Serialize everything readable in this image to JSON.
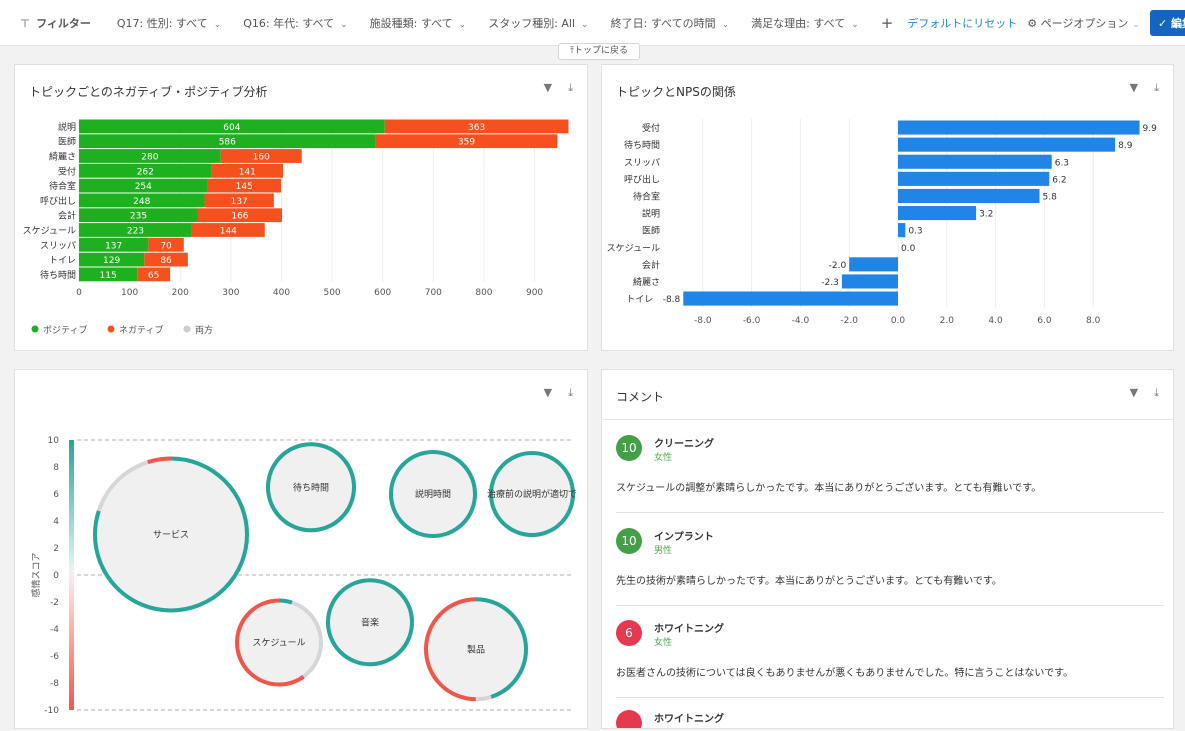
{
  "filterbar": {
    "title": "フィルター",
    "items": [
      "Q17: 性別: すべて",
      "Q16: 年代: すべて",
      "施設種類: すべて",
      "スタッフ種別: All",
      "終了日: すべての時間",
      "満足な理由: すべて"
    ],
    "add": "+",
    "reset": "デフォルトにリセット",
    "options": "ページオプション",
    "done": "編集を完了"
  },
  "back_to_top": "⤒トップに戻る",
  "panels": {
    "sentiment": {
      "title": "トピックごとのネガティブ・ポジティブ分析"
    },
    "nps": {
      "title": "トピックとNPSの関係"
    },
    "bubble": {
      "title": ""
    },
    "comments": {
      "title": "コメント"
    }
  },
  "comments": [
    {
      "score": "10",
      "score_color": "#43a047",
      "topic": "クリーニング",
      "gender": "女性",
      "text": "スケジュールの調整が素晴らしかったです。本当にありがとうございます。とても有難いです。"
    },
    {
      "score": "10",
      "score_color": "#43a047",
      "topic": "インプラント",
      "gender": "男性",
      "text": "先生の技術が素晴らしかったです。本当にありがとうございます。とても有難いです。"
    },
    {
      "score": "6",
      "score_color": "#e53950",
      "topic": "ホワイトニング",
      "gender": "女性",
      "text": "お医者さんの技術については良くもありませんが悪くもありませんでした。特に言うことはないです。"
    },
    {
      "score": "",
      "score_color": "#e53950",
      "topic": "ホワイトニング",
      "gender": "",
      "text": ""
    }
  ],
  "chart_data": [
    {
      "type": "bar",
      "orientation": "horizontal",
      "stacked": true,
      "categories": [
        "説明",
        "医師",
        "綺麗さ",
        "受付",
        "待合室",
        "呼び出し",
        "会計",
        "スケジュール",
        "スリッパ",
        "トイレ",
        "待ち時間"
      ],
      "series": [
        {
          "name": "ポジティブ",
          "color": "#1eb01e",
          "values": [
            604,
            586,
            280,
            262,
            254,
            248,
            235,
            223,
            137,
            129,
            115
          ]
        },
        {
          "name": "ネガティブ",
          "color": "#f4511e",
          "values": [
            363,
            359,
            160,
            141,
            145,
            137,
            166,
            144,
            70,
            86,
            65
          ]
        },
        {
          "name": "両方",
          "color": "#cccccc",
          "values": [
            0,
            0,
            0,
            0,
            0,
            0,
            0,
            0,
            0,
            0,
            0
          ]
        }
      ],
      "xticks": [
        "0",
        "100",
        "200",
        "300",
        "400",
        "500",
        "600",
        "700",
        "800",
        "900"
      ],
      "xlim": [
        0,
        970
      ],
      "legend": "bottom-left"
    },
    {
      "type": "bar",
      "orientation": "horizontal",
      "categories": [
        "受付",
        "待ち時間",
        "スリッパ",
        "呼び出し",
        "待合室",
        "説明",
        "医師",
        "スケジュール",
        "会計",
        "綺麗さ",
        "トイレ"
      ],
      "values": [
        9.9,
        8.9,
        6.3,
        6.2,
        5.8,
        3.2,
        0.3,
        0.0,
        -2.0,
        -2.3,
        -8.8
      ],
      "labels": [
        "9.9",
        "8.9",
        "6.3",
        "6.2",
        "5.8",
        "3.2",
        "0.3",
        "0.0",
        "-2.0",
        "-2.3",
        "-8.8"
      ],
      "color": "#2185e8",
      "xticks": [
        "-8.0",
        "-6.0",
        "-4.0",
        "-2.0",
        "0.0",
        "2.0",
        "4.0",
        "6.0",
        "8.0"
      ],
      "xlim": [
        -9,
        10
      ]
    },
    {
      "type": "scatter",
      "style": "bubble",
      "ylabel": "感情スコア",
      "yticks": [
        "10",
        "8",
        "6",
        "4",
        "2",
        "0",
        "-2",
        "-4",
        "-6",
        "-8",
        "-10"
      ],
      "ylim": [
        -10,
        10
      ],
      "points": [
        {
          "label": "サービス",
          "y": 3,
          "positive_share": 0.8,
          "negative_share": 0.05
        },
        {
          "label": "待ち時間",
          "y": 6.5,
          "positive_share": 1.0,
          "negative_share": 0.0
        },
        {
          "label": "説明時間",
          "y": 6,
          "positive_share": 1.0,
          "negative_share": 0.0
        },
        {
          "label": "治療前の説明が適切で",
          "y": 6,
          "positive_share": 1.0,
          "negative_share": 0.0
        },
        {
          "label": "スケジュール",
          "y": -5,
          "positive_share": 0.05,
          "negative_share": 0.6
        },
        {
          "label": "音楽",
          "y": -3.5,
          "positive_share": 1.0,
          "negative_share": 0.0
        },
        {
          "label": "製品",
          "y": -5.5,
          "positive_share": 0.45,
          "negative_share": 0.5
        }
      ]
    }
  ]
}
